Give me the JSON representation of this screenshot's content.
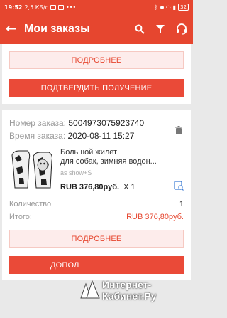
{
  "status_bar": {
    "time": "19:52",
    "speed": "2,5 КБ/с",
    "battery": "32"
  },
  "app_bar": {
    "title": "Мои заказы",
    "back_icon": "arrow-left-icon",
    "search_icon": "search-icon",
    "filter_icon": "filter-icon",
    "support_icon": "headset-icon",
    "color": "#e6462f"
  },
  "order_prev": {
    "details_label": "ПОДРОБНЕЕ",
    "confirm_label": "ПОДТВЕРДИТЬ ПОЛУЧЕНИЕ"
  },
  "order": {
    "number_label": "Номер заказа:",
    "number_value": "5004973075923740",
    "time_label": "Время заказа:",
    "time_value": "2020-08-11 15:27",
    "product": {
      "name_line1": "Большой жилет",
      "name_line2": "для собак, зимняя водон...",
      "seller": "as show+S",
      "price": "RUB 376,80руб.",
      "qty": "X 1"
    },
    "quantity_label": "Количество",
    "quantity_value": "1",
    "total_label": "Итого:",
    "total_value": "RUB 376,80руб.",
    "details_label": "ПОДРОБНЕЕ",
    "more_label": "ДОПОЛ"
  },
  "watermark": {
    "line1": "Интернет-",
    "line2": "Кабинет.Ру"
  }
}
